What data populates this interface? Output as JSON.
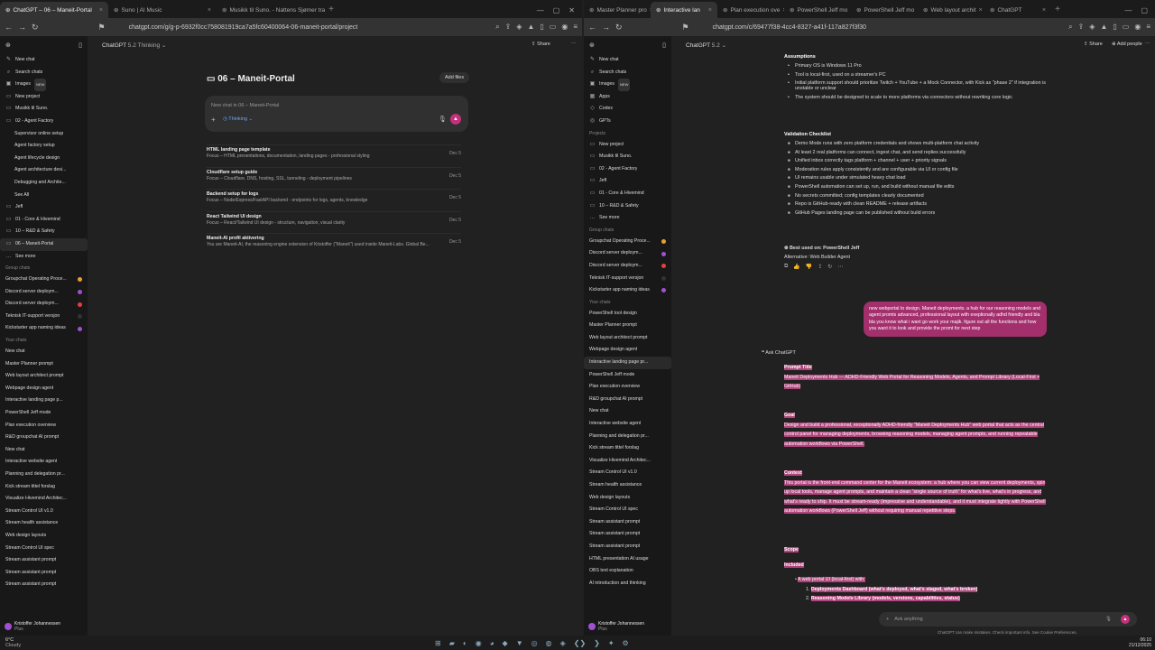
{
  "left": {
    "tabs": [
      {
        "label": "ChatGPT – 06 – Maneit-Portal",
        "active": true
      },
      {
        "label": "Suno | AI Music",
        "active": false
      },
      {
        "label": "Musikk til Suno. - Nattens Sjømer tra",
        "active": false
      }
    ],
    "url": "chatgpt.com/g/g-p-6932f0cc758081919ca7a5fc60400064-06-maneit-portal/project",
    "model": "ChatGPT",
    "model_version": "5.2 Thinking",
    "share": "Share",
    "sidebar": [
      {
        "label": "New chat",
        "kind": "top",
        "icon": "✎"
      },
      {
        "label": "Search chats",
        "kind": "top",
        "icon": "⌕"
      },
      {
        "label": "Images",
        "kind": "top",
        "icon": "▣",
        "badge": "NEW"
      },
      {
        "label": "New project",
        "kind": "top",
        "icon": "▭"
      },
      {
        "label": "Musikk til Suno.",
        "kind": "top",
        "icon": "▭"
      },
      {
        "label": "02 - Agent Factory",
        "kind": "top",
        "icon": "▭"
      },
      {
        "label": "Supervisor online setup",
        "kind": "sub"
      },
      {
        "label": "Agent factory setup",
        "kind": "sub"
      },
      {
        "label": "Agent lifecycle design",
        "kind": "sub"
      },
      {
        "label": "Agent architecture desi...",
        "kind": "sub"
      },
      {
        "label": "Debugging and Archite...",
        "kind": "sub"
      },
      {
        "label": "See All",
        "kind": "sub"
      },
      {
        "label": "Jeff",
        "kind": "top",
        "icon": "▭"
      },
      {
        "label": "01 - Core & Hivemind",
        "kind": "top",
        "icon": "▭"
      },
      {
        "label": "10 – R&D & Safety",
        "kind": "top",
        "icon": "▭"
      },
      {
        "label": "06 – Maneit-Portal",
        "kind": "top",
        "icon": "▭",
        "selected": true
      },
      {
        "label": "See more",
        "kind": "top",
        "icon": "…"
      },
      {
        "label": "Group chats",
        "kind": "head"
      },
      {
        "label": "Groupchat Operating Proce...",
        "kind": "item",
        "dot": "#e8a030"
      },
      {
        "label": "Discord server deploym...",
        "kind": "item",
        "dot": "#a050d0"
      },
      {
        "label": "Discord server deploym...",
        "kind": "item",
        "dot": "#e04040"
      },
      {
        "label": "Teknisk IT-support versjon",
        "kind": "item",
        "dot": "#333"
      },
      {
        "label": "Kickstarter app naming ideas",
        "kind": "item",
        "dot": "#a050d0"
      },
      {
        "label": "Your chats",
        "kind": "head"
      },
      {
        "label": "New chat",
        "kind": "item"
      },
      {
        "label": "Master Planner prompt",
        "kind": "item"
      },
      {
        "label": "Web layout architect prompt",
        "kind": "item"
      },
      {
        "label": "Webpage design agent",
        "kind": "item"
      },
      {
        "label": "Interactive landing page p...",
        "kind": "item"
      },
      {
        "label": "PowerShell Jeff mode",
        "kind": "item"
      },
      {
        "label": "Plan execution overview",
        "kind": "item"
      },
      {
        "label": "R&D groupchat AI prompt",
        "kind": "item"
      },
      {
        "label": "New chat",
        "kind": "item"
      },
      {
        "label": "Interactive website agent",
        "kind": "item"
      },
      {
        "label": "Planning and delegation pr...",
        "kind": "item"
      },
      {
        "label": "Kick stream tittel forslag",
        "kind": "item"
      },
      {
        "label": "Visualize Hivemind Architec...",
        "kind": "item"
      },
      {
        "label": "Stream Control UI v1.0",
        "kind": "item"
      },
      {
        "label": "Stream health assistance",
        "kind": "item"
      },
      {
        "label": "Web design layouts",
        "kind": "item"
      },
      {
        "label": "Stream Control UI spec",
        "kind": "item"
      },
      {
        "label": "Stream assistant prompt",
        "kind": "item"
      },
      {
        "label": "Stream assistant prompt",
        "kind": "item"
      },
      {
        "label": "Stream assistant prompt",
        "kind": "item"
      }
    ],
    "user": {
      "name": "Kristoffer Johannessen",
      "plan": "Plus"
    },
    "project_title": "06 – Maneit-Portal",
    "add_files": "Add files",
    "new_chat_placeholder": "New chat in 06 – Maneit-Portal",
    "thinking": "Thinking",
    "chats": [
      {
        "title": "HTML landing page template",
        "sub": "Focus – HTML presentations, documentation, landing pages - professional styling",
        "date": "Dec 5"
      },
      {
        "title": "Cloudflare setup guide",
        "sub": "Focus – Cloudflare, DNS, hosting, SSL, tunneling - deployment pipelines",
        "date": "Dec 5"
      },
      {
        "title": "Backend setup for logs",
        "sub": "Focus – Node/Express/FastAPI backend - endpoints for logs, agents, knowledge",
        "date": "Dec 5"
      },
      {
        "title": "React Tailwind UI design",
        "sub": "Focus – React/Tailwind UI design - structure, navigation, visual clarity",
        "date": "Dec 5"
      },
      {
        "title": "Maneit-AI profil aktivering",
        "sub": "You are Maneit-AI, the reasoning engine extension of Kristoffer (\"Maneit\") used inside Maneit-Labs. Global Be...",
        "date": "Dec 5"
      }
    ]
  },
  "right": {
    "tabs": [
      {
        "label": "Master Planner pro",
        "active": false
      },
      {
        "label": "Interactive lan",
        "active": true
      },
      {
        "label": "Plan execution ove",
        "active": false
      },
      {
        "label": "PowerShell Jeff mo",
        "active": false
      },
      {
        "label": "PowerShell Jeff mo",
        "active": false
      },
      {
        "label": "Web layout archit",
        "active": false
      },
      {
        "label": "ChatGPT",
        "active": false
      }
    ],
    "url": "chatgpt.com/c/69477f38-4cc4-8327-a41f-117a827f3f30",
    "model": "ChatGPT",
    "model_version": "5.2",
    "share": "Share",
    "add_people": "Add people",
    "sidebar": [
      {
        "label": "New chat",
        "kind": "top",
        "icon": "✎"
      },
      {
        "label": "Search chats",
        "kind": "top",
        "icon": "⌕"
      },
      {
        "label": "Images",
        "kind": "top",
        "icon": "▣",
        "badge": "NEW"
      },
      {
        "label": "Apps",
        "kind": "top",
        "icon": "▦"
      },
      {
        "label": "Codex",
        "kind": "top",
        "icon": "◇"
      },
      {
        "label": "GPTs",
        "kind": "top",
        "icon": "◎"
      },
      {
        "label": "Projects",
        "kind": "head"
      },
      {
        "label": "New project",
        "kind": "top",
        "icon": "▭"
      },
      {
        "label": "Musikk til Suno.",
        "kind": "top",
        "icon": "▭"
      },
      {
        "label": "02 - Agent Factory",
        "kind": "top",
        "icon": "▭"
      },
      {
        "label": "Jeff",
        "kind": "top",
        "icon": "▭"
      },
      {
        "label": "01 - Core & Hivemind",
        "kind": "top",
        "icon": "▭"
      },
      {
        "label": "10 – R&D & Safety",
        "kind": "top",
        "icon": "▭"
      },
      {
        "label": "See more",
        "kind": "top",
        "icon": "…"
      },
      {
        "label": "Group chats",
        "kind": "head"
      },
      {
        "label": "Groupchat Operating Proce...",
        "kind": "item",
        "dot": "#e8a030"
      },
      {
        "label": "Discord server deploym...",
        "kind": "item",
        "dot": "#a050d0"
      },
      {
        "label": "Discord server deploym...",
        "kind": "item",
        "dot": "#e04040"
      },
      {
        "label": "Teknisk IT-support versjon",
        "kind": "item",
        "dot": "#333"
      },
      {
        "label": "Kickstarter app naming ideas",
        "kind": "item",
        "dot": "#a050d0"
      },
      {
        "label": "Your chats",
        "kind": "head"
      },
      {
        "label": "PowerShell tool design",
        "kind": "item"
      },
      {
        "label": "Master Planner prompt",
        "kind": "item"
      },
      {
        "label": "Web layout architect prompt",
        "kind": "item"
      },
      {
        "label": "Webpage design agent",
        "kind": "item"
      },
      {
        "label": "Interactive landing page pr...",
        "kind": "item",
        "selected": true
      },
      {
        "label": "PowerShell Jeff mode",
        "kind": "item"
      },
      {
        "label": "Plan execution overview",
        "kind": "item"
      },
      {
        "label": "R&D groupchat AI prompt",
        "kind": "item"
      },
      {
        "label": "New chat",
        "kind": "item"
      },
      {
        "label": "Interactive website agent",
        "kind": "item"
      },
      {
        "label": "Planning and delegation pr...",
        "kind": "item"
      },
      {
        "label": "Kick stream tittel forslag",
        "kind": "item"
      },
      {
        "label": "Visualize Hivemind Architec...",
        "kind": "item"
      },
      {
        "label": "Stream Control UI v1.0",
        "kind": "item"
      },
      {
        "label": "Stream health assistance",
        "kind": "item"
      },
      {
        "label": "Web design layouts",
        "kind": "item"
      },
      {
        "label": "Stream Control UI spec",
        "kind": "item"
      },
      {
        "label": "Stream assistant prompt",
        "kind": "item"
      },
      {
        "label": "Stream assistant prompt",
        "kind": "item"
      },
      {
        "label": "Stream assistant prompt",
        "kind": "item"
      },
      {
        "label": "HTML presentation AI usage",
        "kind": "item"
      },
      {
        "label": "OBS text explanation",
        "kind": "item"
      },
      {
        "label": "AI introduction and thinking",
        "kind": "item"
      }
    ],
    "user": {
      "name": "Kristoffer Johannessen",
      "plan": "Plus"
    },
    "assumptions_title": "Assumptions",
    "assumptions": [
      "Primary OS is Windows 11 Pro",
      "Tool is local-first, used on a streamer's PC",
      "Initial platform support should prioritize Twitch + YouTube + a Mock Connector, with Kick as \"phase 2\" if integration is unstable or unclear",
      "The system should be designed to scale to more platforms via connectors without rewriting core logic"
    ],
    "checklist_title": "Validation Checklist",
    "checklist": [
      "Demo Mode runs with zero platform credentials and shows multi-platform chat activity",
      "At least 2 real platforms can connect, ingest chat, and send replies successfully",
      "Unified inbox correctly tags platform + channel + user + priority signals",
      "Moderation rules apply consistently and are configurable via UI or config file",
      "UI remains usable under simulated heavy chat load",
      "PowerShell automation can set up, run, and build without manual file edits",
      "No secrets committed; config templates clearly documented",
      "Repo is GitHub-ready with clean README + release artifacts",
      "GitHub Pages landing page can be published without build errors"
    ],
    "best_used": "Best used on: PowerShell Jeff",
    "alternative": "Alternative: Web Builder Agent",
    "user_message": "new webportal to design. Maneit deployments. a hub for our reasoning models and agent promts advanced, professional layout with exeptionally adhd friendly and bla bla you know what i want go work your majik. figure out all the functions and how you want it to look and provide the promt for next step",
    "ask_chatgpt": "Ask ChatGPT",
    "prompt_title_label": "Prompt Title",
    "prompt_title": "Maneit Deployments Hub — ADHD-Friendly Web Portal for Reasoning Models, Agents, and Prompt Library (Local-First + GitHub)",
    "goal_label": "Goal",
    "goal": "Design and build a professional, exceptionally ADHD-friendly \"Maneit Deployments Hub\" web portal that acts as the central control panel for managing deployments, browsing reasoning models, managing agent prompts, and running repeatable automation workflows via PowerShell.",
    "context_label": "Context",
    "context": "This portal is the front-end command center for the Maneit ecosystem: a hub where you can view current deployments, spin up local tools, manage agent prompts, and maintain a clean \"single source of truth\" for what's live, what's in progress, and what's ready to ship. It must be stream-ready (impressive and understandable), and it must integrate tightly with PowerShell automation workflows (PowerShell Jeff) without requiring manual repetitive steps.",
    "scope_label": "Scope",
    "included_label": "Included",
    "scope_item": "A web portal UI (local-first) with:",
    "scope_sub": [
      "Deployments Dashboard (what's deployed, what's staged, what's broken)",
      "Reasoning Models Library (models, versions, capabilities, status)"
    ],
    "composer_placeholder": "Ask anything",
    "footer": "ChatGPT can make mistakes. Check important info. See Cookie Preferences."
  },
  "taskbar": {
    "temp": "6°C",
    "weather": "Cloudy",
    "time": "06:10",
    "date": "21/12/2025"
  }
}
